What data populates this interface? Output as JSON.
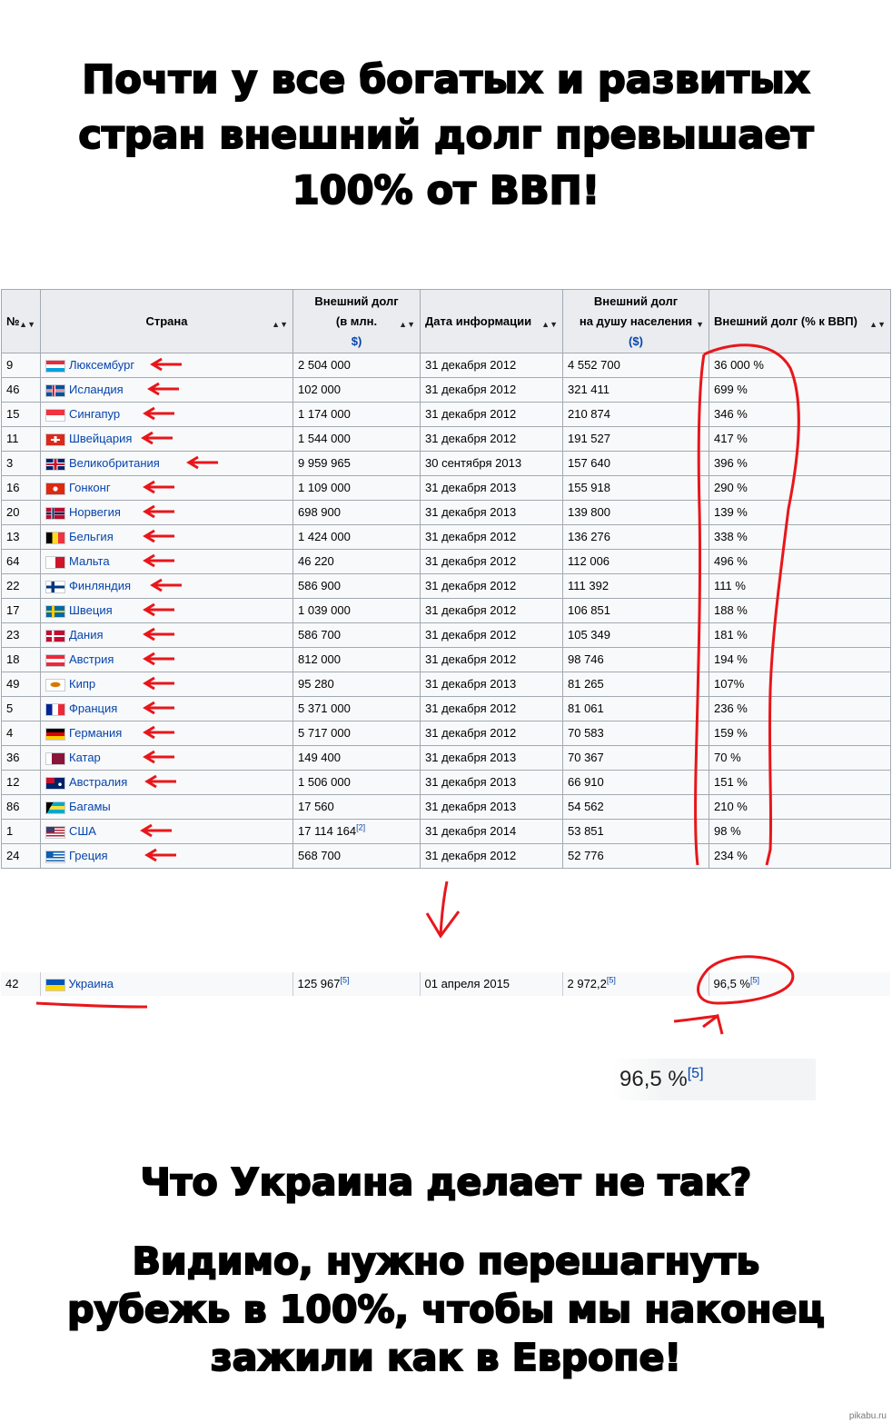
{
  "title": "Почти у все богатых и развитых стран внешний долг превышает 100% от ВВП!",
  "title_lines": [
    "Почти у все богатых и развитых",
    "стран внешний долг превышает",
    "100% от ВВП!"
  ],
  "table": {
    "headers": {
      "num": "№",
      "country": "Страна",
      "debt_line1": "Внешний долг",
      "debt_line2": "(в млн.",
      "debt_line3": "$)",
      "date": "Дата информации",
      "percap_line1": "Внешний долг",
      "percap_line2": "на душу населения",
      "percap_line3": "($)",
      "pct": "Внешний долг (% к ВВП)"
    },
    "rows": [
      {
        "num": "9",
        "country": "Люксембург",
        "debt": "2 504 000",
        "date": "31 декабря 2012",
        "percap": "4 552 700",
        "pct": "36 000 %",
        "flag": "lu"
      },
      {
        "num": "46",
        "country": "Исландия",
        "debt": "102 000",
        "date": "31 декабря 2012",
        "percap": "321 411",
        "pct": "699 %",
        "flag": "is"
      },
      {
        "num": "15",
        "country": "Сингапур",
        "debt": "1 174 000",
        "date": "31 декабря 2012",
        "percap": "210 874",
        "pct": "346 %",
        "flag": "sg"
      },
      {
        "num": "11",
        "country": "Швейцария",
        "debt": "1 544 000",
        "date": "31 декабря 2012",
        "percap": "191 527",
        "pct": "417 %",
        "flag": "ch"
      },
      {
        "num": "3",
        "country": "Великобритания",
        "debt": "9 959 965",
        "date": "30 сентября 2013",
        "percap": "157 640",
        "pct": "396 %",
        "flag": "gb"
      },
      {
        "num": "16",
        "country": "Гонконг",
        "debt": "1 109 000",
        "date": "31 декабря 2013",
        "percap": "155 918",
        "pct": "290 %",
        "flag": "hk"
      },
      {
        "num": "20",
        "country": "Норвегия",
        "debt": "698 900",
        "date": "31 декабря 2013",
        "percap": "139 800",
        "pct": "139 %",
        "flag": "no"
      },
      {
        "num": "13",
        "country": "Бельгия",
        "debt": "1 424 000",
        "date": "31 декабря 2012",
        "percap": "136 276",
        "pct": "338 %",
        "flag": "be"
      },
      {
        "num": "64",
        "country": "Мальта",
        "debt": "46 220",
        "date": "31 декабря 2012",
        "percap": "112 006",
        "pct": "496 %",
        "flag": "mt"
      },
      {
        "num": "22",
        "country": "Финляндия",
        "debt": "586 900",
        "date": "31 декабря 2012",
        "percap": "111 392",
        "pct": "111 %",
        "flag": "fi"
      },
      {
        "num": "17",
        "country": "Швеция",
        "debt": "1 039 000",
        "date": "31 декабря 2012",
        "percap": "106 851",
        "pct": "188 %",
        "flag": "se"
      },
      {
        "num": "23",
        "country": "Дания",
        "debt": "586 700",
        "date": "31 декабря 2012",
        "percap": "105 349",
        "pct": "181 %",
        "flag": "dk"
      },
      {
        "num": "18",
        "country": "Австрия",
        "debt": "812 000",
        "date": "31 декабря 2012",
        "percap": "98 746",
        "pct": "194 %",
        "flag": "at"
      },
      {
        "num": "49",
        "country": "Кипр",
        "debt": "95 280",
        "date": "31 декабря 2013",
        "percap": "81 265",
        "pct": "107%",
        "flag": "cy"
      },
      {
        "num": "5",
        "country": "Франция",
        "debt": "5 371 000",
        "date": "31 декабря 2012",
        "percap": "81 061",
        "pct": "236 %",
        "flag": "fr"
      },
      {
        "num": "4",
        "country": "Германия",
        "debt": "5 717 000",
        "date": "31 декабря 2012",
        "percap": "70 583",
        "pct": "159 %",
        "flag": "de"
      },
      {
        "num": "36",
        "country": "Катар",
        "debt": "149 400",
        "date": "31 декабря 2013",
        "percap": "70 367",
        "pct": "70 %",
        "flag": "qa"
      },
      {
        "num": "12",
        "country": "Австралия",
        "debt": "1 506 000",
        "date": "31 декабря 2013",
        "percap": "66 910",
        "pct": "151 %",
        "flag": "au"
      },
      {
        "num": "86",
        "country": "Багамы",
        "debt": "17 560",
        "date": "31 декабря 2013",
        "percap": "54 562",
        "pct": "210 %",
        "flag": "bs"
      },
      {
        "num": "1",
        "country": "США",
        "debt": "17 114 164",
        "debt_ref": "[2]",
        "date": "31 декабря 2014",
        "percap": "53 851",
        "pct": "98 %",
        "flag": "us"
      },
      {
        "num": "24",
        "country": "Греция",
        "debt": "568 700",
        "date": "31 декабря 2012",
        "percap": "52 776",
        "pct": "234 %",
        "flag": "gr"
      }
    ]
  },
  "ukraine_row": {
    "num": "42",
    "country": "Украина",
    "debt": "125 967",
    "debt_ref": "[5]",
    "date": "01 апреля 2015",
    "percap": "2 972,2",
    "percap_ref": "[5]",
    "pct": "96,5 %",
    "pct_ref": "[5]",
    "flag": "ua"
  },
  "zoom": {
    "value": "96,5 %",
    "ref": "[5]"
  },
  "question": "Что Украина делает не так?",
  "conclusion_lines": [
    "Видимо, нужно перешагнуть",
    "рубежь в 100%, чтобы мы наконец",
    "зажили как в Европе!"
  ],
  "watermark": "pikabu.ru",
  "colors": {
    "annotation": "#e8161b",
    "link": "#0645ad",
    "header_bg": "#eaecf0",
    "cell_bg": "#f8f9fa",
    "border": "#a2a9b1"
  }
}
